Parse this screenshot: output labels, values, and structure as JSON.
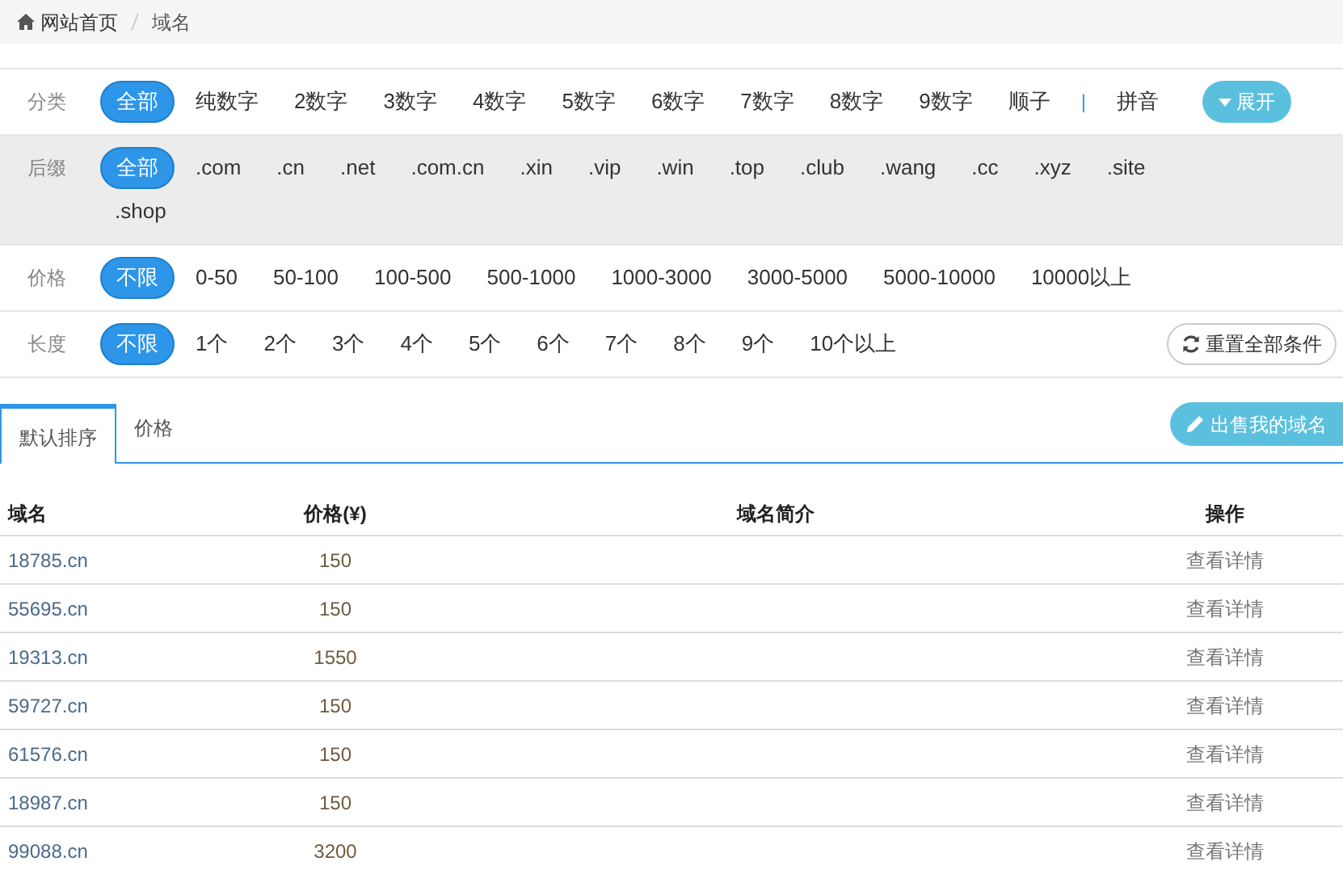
{
  "breadcrumb": [
    {
      "label": "网站首页",
      "kind": "home"
    },
    {
      "label": "域名",
      "kind": "current"
    }
  ],
  "filters": [
    {
      "label": "分类",
      "shaded": false,
      "items": [
        {
          "label": "全部",
          "selected": true
        },
        {
          "label": "纯数字",
          "selected": false
        },
        {
          "label": "2数字",
          "selected": false
        },
        {
          "label": "3数字",
          "selected": false
        },
        {
          "label": "4数字",
          "selected": false
        },
        {
          "label": "5数字",
          "selected": false
        },
        {
          "label": "6数字",
          "selected": false
        },
        {
          "label": "7数字",
          "selected": false
        },
        {
          "label": "8数字",
          "selected": false
        },
        {
          "label": "9数字",
          "selected": false
        },
        {
          "label": "顺子",
          "selected": false
        },
        {
          "label": "|",
          "kind": "divider"
        },
        {
          "label": "拼音",
          "selected": false
        }
      ],
      "action": {
        "label": "展开",
        "kind": "expand"
      }
    },
    {
      "label": "后缀",
      "shaded": true,
      "items": [
        {
          "label": "全部",
          "selected": true
        },
        {
          "label": ".com",
          "selected": false
        },
        {
          "label": ".cn",
          "selected": false
        },
        {
          "label": ".net",
          "selected": false
        },
        {
          "label": ".com.cn",
          "selected": false
        },
        {
          "label": ".xin",
          "selected": false
        },
        {
          "label": ".vip",
          "selected": false
        },
        {
          "label": ".win",
          "selected": false
        },
        {
          "label": ".top",
          "selected": false
        },
        {
          "label": ".club",
          "selected": false
        },
        {
          "label": ".wang",
          "selected": false
        },
        {
          "label": ".cc",
          "selected": false
        },
        {
          "label": ".xyz",
          "selected": false
        },
        {
          "label": ".site",
          "selected": false
        },
        {
          "label": ".shop",
          "selected": false
        }
      ]
    },
    {
      "label": "价格",
      "shaded": false,
      "items": [
        {
          "label": "不限",
          "selected": true
        },
        {
          "label": "0-50",
          "selected": false
        },
        {
          "label": "50-100",
          "selected": false
        },
        {
          "label": "100-500",
          "selected": false
        },
        {
          "label": "500-1000",
          "selected": false
        },
        {
          "label": "1000-3000",
          "selected": false
        },
        {
          "label": "3000-5000",
          "selected": false
        },
        {
          "label": "5000-10000",
          "selected": false
        },
        {
          "label": "10000以上",
          "selected": false
        }
      ]
    },
    {
      "label": "长度",
      "shaded": false,
      "items": [
        {
          "label": "不限",
          "selected": true
        },
        {
          "label": "1个",
          "selected": false
        },
        {
          "label": "2个",
          "selected": false
        },
        {
          "label": "3个",
          "selected": false
        },
        {
          "label": "4个",
          "selected": false
        },
        {
          "label": "5个",
          "selected": false
        },
        {
          "label": "6个",
          "selected": false
        },
        {
          "label": "7个",
          "selected": false
        },
        {
          "label": "8个",
          "selected": false
        },
        {
          "label": "9个",
          "selected": false
        },
        {
          "label": "10个以上",
          "selected": false
        }
      ],
      "action": {
        "label": "重置全部条件",
        "kind": "reset"
      }
    }
  ],
  "tabs": [
    {
      "label": "默认排序",
      "selected": true
    },
    {
      "label": "价格",
      "selected": false
    }
  ],
  "sell_button": "出售我的域名",
  "table": {
    "columns": [
      "域名",
      "价格(¥)",
      "域名简介",
      "操作"
    ],
    "rows": [
      {
        "domain": "18785.cn",
        "price": "150",
        "action": "查看详情"
      },
      {
        "domain": "55695.cn",
        "price": "150",
        "action": "查看详情"
      },
      {
        "domain": "19313.cn",
        "price": "1550",
        "action": "查看详情"
      },
      {
        "domain": "59727.cn",
        "price": "150",
        "action": "查看详情"
      },
      {
        "domain": "61576.cn",
        "price": "150",
        "action": "查看详情"
      },
      {
        "domain": "18987.cn",
        "price": "150",
        "action": "查看详情"
      },
      {
        "domain": "99088.cn",
        "price": "3200",
        "action": "查看详情"
      }
    ]
  }
}
